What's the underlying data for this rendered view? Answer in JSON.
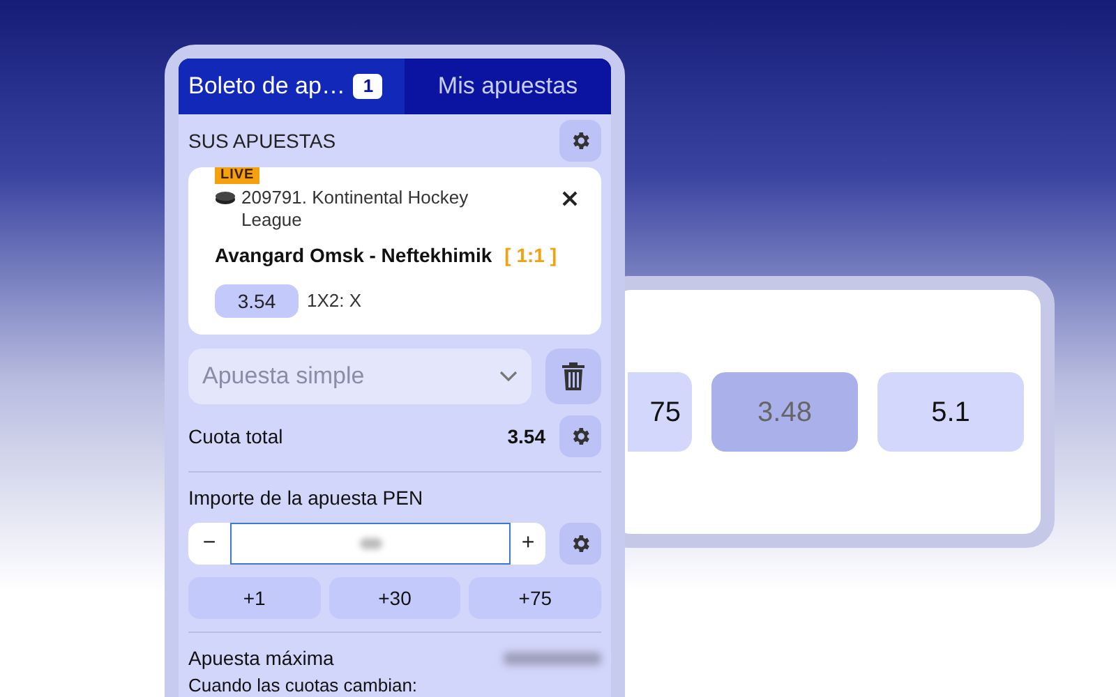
{
  "background_card": {
    "odds": [
      {
        "label": "75",
        "selected": false
      },
      {
        "label": "3.48",
        "selected": true
      },
      {
        "label": "5.1",
        "selected": false
      }
    ]
  },
  "tabs": [
    {
      "label": "Boleto de ap…",
      "badge": "1",
      "selected": true
    },
    {
      "label": "Mis apuestas",
      "selected": false
    }
  ],
  "section_title": "SUS APUESTAS",
  "bet": {
    "live_badge": "LIVE",
    "league": "209791. Kontinental Hockey League",
    "match": "Avangard Omsk - Neftekhimik",
    "score": "[ 1:1 ]",
    "odds": "3.54",
    "market": "1X2: X"
  },
  "bet_type": {
    "placeholder": "Apuesta simple"
  },
  "total_odds": {
    "label": "Cuota total",
    "value": "3.54"
  },
  "stake": {
    "label": "Importe de la apuesta PEN",
    "minus": "−",
    "plus": "+",
    "quick_amounts": [
      "+1",
      "+30",
      "+75"
    ]
  },
  "max_bet": {
    "label": "Apuesta máxima"
  },
  "odds_change_label": "Cuando las cuotas cambian:"
}
